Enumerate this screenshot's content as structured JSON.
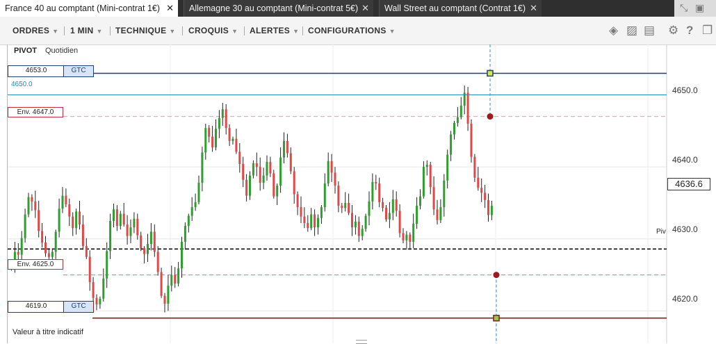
{
  "tabs": [
    {
      "label": "France 40 au comptant (Mini-contrat 1€)",
      "active": true
    },
    {
      "label": "Allemagne 30 au comptant (Mini-contrat 5€)",
      "active": false
    },
    {
      "label": "Wall Street au comptant (Contrat 1€)",
      "active": false
    }
  ],
  "tab_close_glyph": "✕",
  "menu": {
    "ordres": "ORDRES",
    "timeframe": "1 MIN",
    "technique": "TECHNIQUE",
    "croquis": "CROQUIS",
    "alertes": "ALERTES",
    "configurations": "CONFIGURATIONS"
  },
  "toolbar_icons": [
    "layers-icon",
    "image-icon",
    "print-icon",
    "gear-icon",
    "help-icon",
    "popout-icon"
  ],
  "chart": {
    "title": "PIVOT",
    "subtitle": "Quotidien",
    "footer_note": "Valeur à titre indicatif",
    "pivot_label": "Piv",
    "current_price": "4636.6",
    "y_ticks": [
      "4650.0",
      "4640.0",
      "4630.0",
      "4620.0"
    ],
    "orders": {
      "top": {
        "price": "4653.0",
        "tif": "GTC"
      },
      "bottom": {
        "price": "4619.0",
        "tif": "GTC"
      }
    },
    "envelopes": {
      "upper": "Env. 4647.0",
      "lower": "Env. 4625.0"
    },
    "alert_line_label": "4650.0",
    "colors": {
      "up": "#2e9e2e",
      "down": "#e04848",
      "order_line": "#1f3f7a",
      "stop_line": "#8b1a1a",
      "alert_line": "#1a8fc0"
    }
  },
  "chart_data": {
    "type": "candlestick",
    "ylim": [
      4615.5,
      4657
    ],
    "levels": {
      "order_top": 4653,
      "alert": 4650,
      "env_upper": 4647,
      "pivot": 4628.6,
      "env_lower": 4625,
      "order_bottom": 4619
    },
    "closes": [
      4626.5,
      4628.2,
      4627.8,
      4630.1,
      4633.4,
      4635.8,
      4635.2,
      4634.0,
      4631.1,
      4629.5,
      4628.0,
      4627.5,
      4628.2,
      4631.0,
      4634.2,
      4636.0,
      4634.8,
      4633.1,
      4631.5,
      4633.8,
      4632.0,
      4629.0,
      4627.5,
      4624.0,
      4621.8,
      4620.9,
      4621.7,
      4624.5,
      4628.3,
      4632.5,
      4634.1,
      4631.8,
      4633.5,
      4632.0,
      4630.4,
      4631.6,
      4632.8,
      4630.5,
      4628.7,
      4627.9,
      4629.3,
      4631.0,
      4628.2,
      4625.4,
      4622.1,
      4621.0,
      4623.5,
      4625.0,
      4623.8,
      4625.9,
      4629.6,
      4631.8,
      4633.2,
      4634.4,
      4635.1,
      4637.8,
      4642.0,
      4645.4,
      4644.2,
      4642.7,
      4645.3,
      4646.8,
      4648.0,
      4645.4,
      4643.6,
      4643.9,
      4642.1,
      4640.4,
      4638.2,
      4636.0,
      4638.8,
      4640.5,
      4640.0,
      4637.8,
      4638.8,
      4640.7,
      4639.1,
      4635.9,
      4637.4,
      4641.3,
      4643.6,
      4641.9,
      4639.4,
      4636.2,
      4634.4,
      4633.1,
      4632.2,
      4631.5,
      4633.4,
      4631.6,
      4632.9,
      4634.4,
      4637.7,
      4640.8,
      4639.2,
      4637.4,
      4634.6,
      4634.3,
      4635.0,
      4633.6,
      4631.6,
      4632.4,
      4630.4,
      4631.4,
      4633.2,
      4635.2,
      4637.9,
      4637.7,
      4635.1,
      4634.3,
      4632.7,
      4633.6,
      4635.5,
      4633.9,
      4630.8,
      4629.8,
      4630.6,
      4629.6,
      4632.1,
      4634.6,
      4635.9,
      4640.0,
      4640.3,
      4637.2,
      4634.1,
      4632.6,
      4634.4,
      4638.1,
      4641.7,
      4644.5,
      4646.1,
      4646.9,
      4648.5,
      4650.3,
      4646.0,
      4641.4,
      4638.5,
      4637.1,
      4636.4,
      4635.4,
      4633.3,
      4634.6
    ]
  }
}
